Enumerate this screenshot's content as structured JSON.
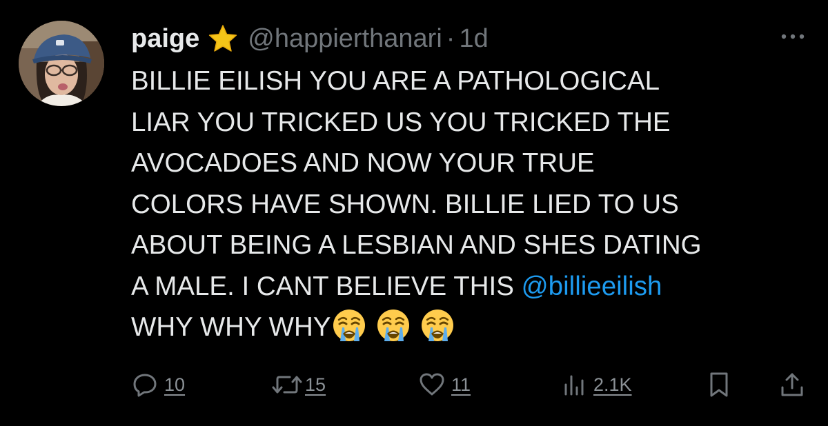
{
  "user": {
    "display_name": "paige",
    "handle": "@happierthanari",
    "separator": "·",
    "time": "1d",
    "badge_icon": "star-icon",
    "avatar_icon": "avatar"
  },
  "tweet": {
    "line1": "BILLIE EILISH YOU ARE A PATHOLOGICAL",
    "line2": "LIAR YOU TRICKED US YOU TRICKED THE",
    "line3": "AVOCADOES AND NOW YOUR TRUE",
    "line4": "COLORS HAVE SHOWN. BILLIE LIED TO US",
    "line5": "ABOUT BEING A LESBIAN AND SHES DATING",
    "line6_prefix": "A MALE. I CANT BELIEVE THIS ",
    "mention": "@billieeilish",
    "line7": "WHY WHY WHY",
    "emoji_name": "loudly-crying-face-emoji",
    "emoji_count": 3
  },
  "actions": {
    "replies": "10",
    "reposts": "15",
    "likes": "11",
    "views": "2.1K"
  },
  "colors": {
    "background": "#000000",
    "text": "#e7e9ea",
    "muted": "#71767b",
    "link": "#1d9bf0",
    "badge": "#f5c518"
  },
  "icons": {
    "more": "more-horizontal-icon",
    "reply": "reply-icon",
    "repost": "repost-icon",
    "like": "heart-icon",
    "views": "views-chart-icon",
    "bookmark": "bookmark-icon",
    "share": "share-icon"
  }
}
